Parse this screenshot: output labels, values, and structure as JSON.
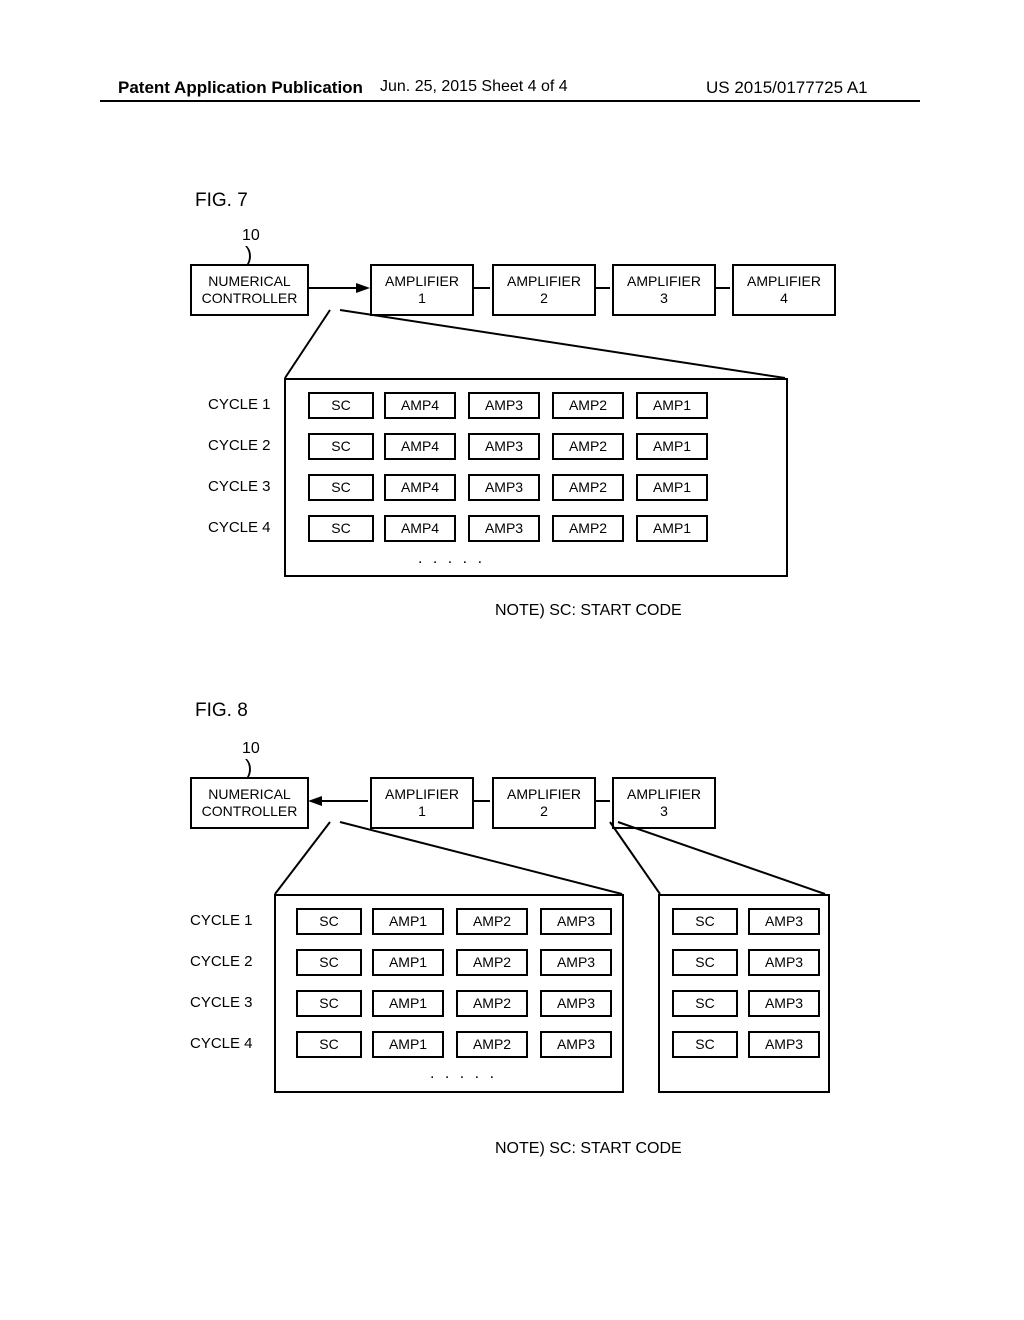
{
  "header": {
    "left": "Patent Application Publication",
    "mid": "Jun. 25, 2015  Sheet 4 of 4",
    "right": "US 2015/0177725 A1"
  },
  "fig7": {
    "label": "FIG. 7",
    "ref_num": "10",
    "numerical_controller": "NUMERICAL\nCONTROLLER",
    "amp1": "AMPLIFIER\n1",
    "amp2": "AMPLIFIER\n2",
    "amp3": "AMPLIFIER\n3",
    "amp4": "AMPLIFIER\n4",
    "cycles": [
      "CYCLE 1",
      "CYCLE 2",
      "CYCLE 3",
      "CYCLE 4"
    ],
    "row_cells": [
      "SC",
      "AMP4",
      "AMP3",
      "AMP2",
      "AMP1"
    ],
    "ellipsis": ". . . . .",
    "note": "NOTE)  SC: START CODE"
  },
  "fig8": {
    "label": "FIG. 8",
    "ref_num": "10",
    "numerical_controller": "NUMERICAL\nCONTROLLER",
    "amp1": "AMPLIFIER\n1",
    "amp2": "AMPLIFIER\n2",
    "amp3": "AMPLIFIER\n3",
    "cycles": [
      "CYCLE 1",
      "CYCLE 2",
      "CYCLE 3",
      "CYCLE 4"
    ],
    "row_cells_left": [
      "SC",
      "AMP1",
      "AMP2",
      "AMP3"
    ],
    "row_cells_right": [
      "SC",
      "AMP3"
    ],
    "ellipsis": ". . . . .",
    "note": "NOTE)  SC: START CODE"
  }
}
